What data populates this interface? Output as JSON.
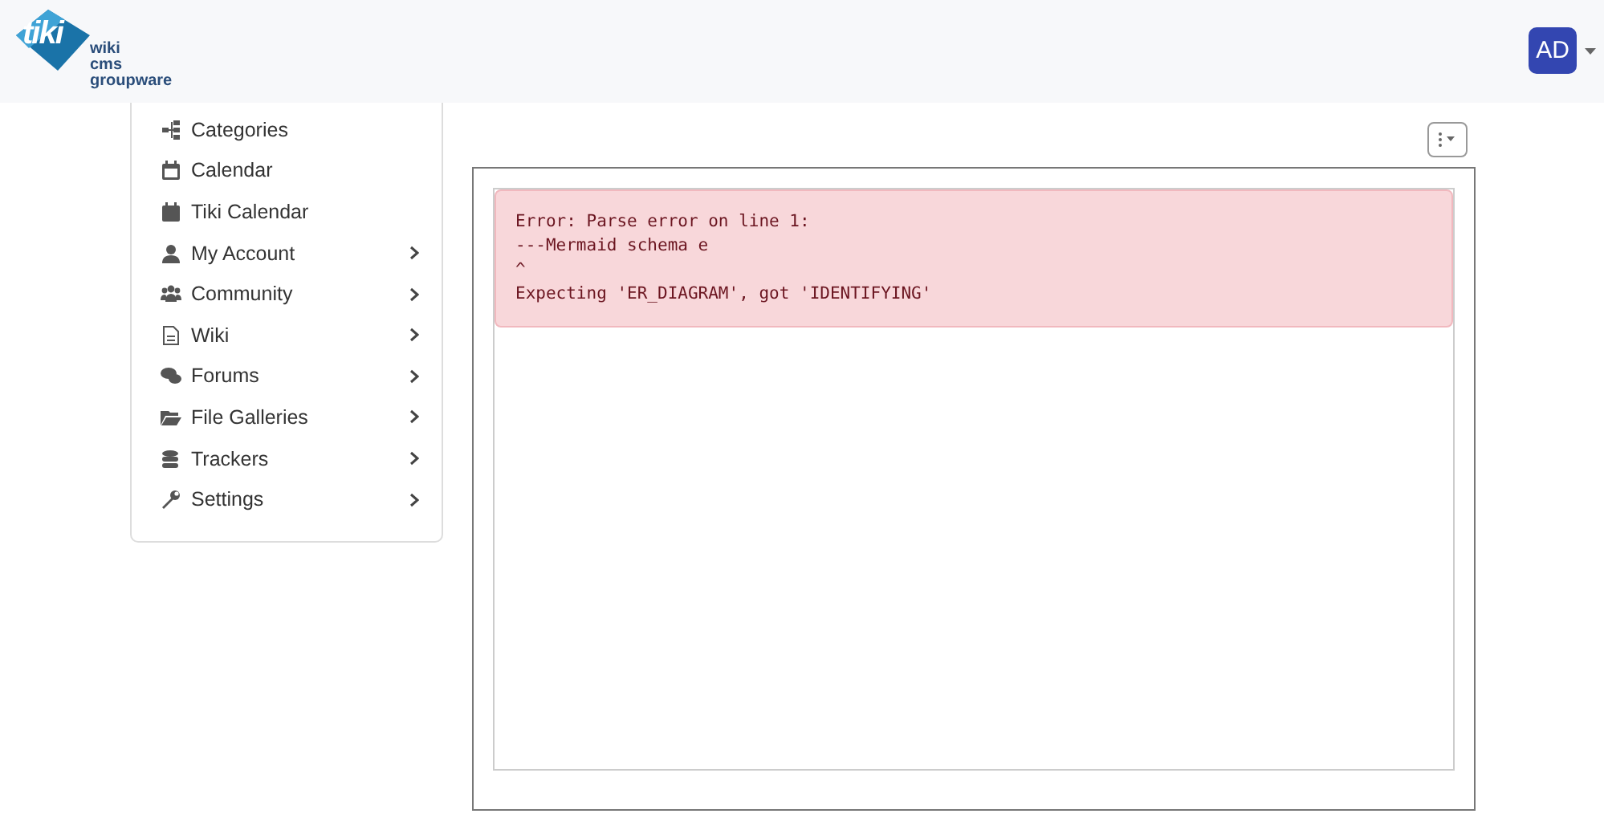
{
  "header": {
    "logo": {
      "mark": "tiki",
      "lines": [
        "wiki",
        "cms",
        "groupware"
      ]
    },
    "user_avatar": "AD"
  },
  "sidebar": {
    "items": [
      {
        "label": "Categories",
        "has_submenu": false
      },
      {
        "label": "Calendar",
        "has_submenu": false
      },
      {
        "label": "Tiki Calendar",
        "has_submenu": false
      },
      {
        "label": "My Account",
        "has_submenu": true
      },
      {
        "label": "Community",
        "has_submenu": true
      },
      {
        "label": "Wiki",
        "has_submenu": true
      },
      {
        "label": "Forums",
        "has_submenu": true
      },
      {
        "label": "File Galleries",
        "has_submenu": true
      },
      {
        "label": "Trackers",
        "has_submenu": true
      },
      {
        "label": "Settings",
        "has_submenu": true
      }
    ]
  },
  "content": {
    "error_lines": [
      "Error: Parse error on line 1:",
      "---Mermaid schema e",
      "^",
      "Expecting 'ER_DIAGRAM', got 'IDENTIFYING'"
    ]
  }
}
